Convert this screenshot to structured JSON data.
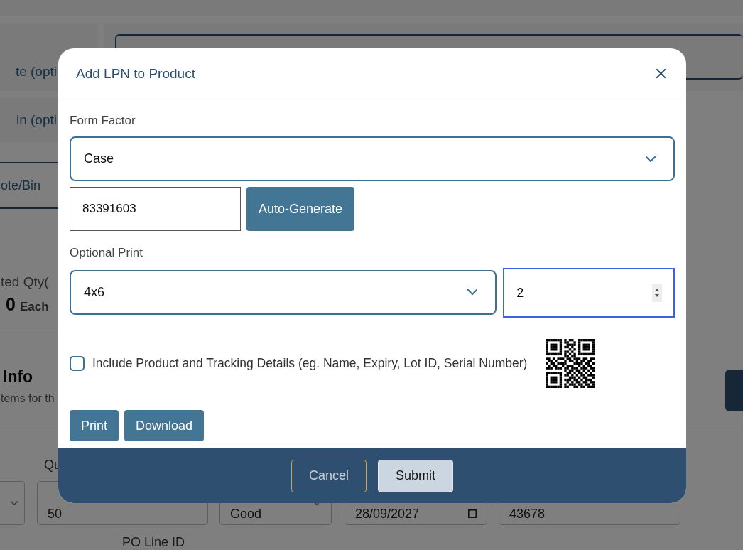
{
  "page": {
    "side_labels": [
      "te (opti",
      "in (opti"
    ],
    "tab": "ote/Bin",
    "qty_label": "ted Qty(",
    "qty_value": "0",
    "qty_unit": "Each",
    "section_title": "Info",
    "section_text": "tems for th",
    "field_label": "Qu",
    "fields": [
      {
        "kind": "select"
      },
      {
        "kind": "input",
        "value": "50"
      },
      {
        "kind": "select",
        "value": "Good"
      },
      {
        "kind": "date",
        "value": "28/09/2027"
      },
      {
        "kind": "input",
        "value": "43678"
      }
    ],
    "po_label": "PO Line ID"
  },
  "dialog": {
    "title": "Add LPN to Product",
    "form_factor": {
      "label": "Form Factor",
      "value": "Case"
    },
    "lpn": {
      "value": "83391603"
    },
    "auto_generate": "Auto-Generate",
    "optional_print": {
      "label": "Optional Print",
      "size": "4x6",
      "copies": "2",
      "copies_focused": true
    },
    "include_details": {
      "label": "Include Product and Tracking Details (eg. Name, Expiry, Lot ID, Serial Number)",
      "checked": false
    },
    "actions": [
      "Print",
      "Download"
    ],
    "footer_buttons": [
      {
        "label": "Cancel",
        "kind": "secondary"
      },
      {
        "label": "Submit",
        "kind": "primary"
      }
    ]
  }
}
